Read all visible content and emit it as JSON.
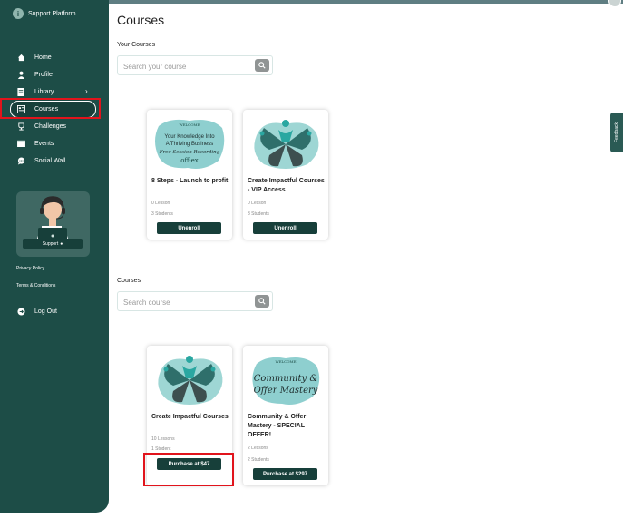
{
  "app": {
    "brand_name": "Support Platform"
  },
  "sidebar": {
    "items": [
      {
        "label": "Home",
        "icon": "home-icon"
      },
      {
        "label": "Profile",
        "icon": "person-icon"
      },
      {
        "label": "Library",
        "icon": "document-icon"
      },
      {
        "label": "Courses",
        "icon": "courses-icon"
      },
      {
        "label": "Challenges",
        "icon": "trophy-icon"
      },
      {
        "label": "Events",
        "icon": "calendar-icon"
      },
      {
        "label": "Social Wall",
        "icon": "chat-icon"
      }
    ],
    "support_label": "Support",
    "privacy_label": "Privacy Policy",
    "terms_label": "Terms & Conditions",
    "logout_label": "Log Out"
  },
  "page": {
    "title": "Courses"
  },
  "your_courses": {
    "heading": "Your Courses",
    "search_placeholder": "Search your course",
    "cards": [
      {
        "title": "8 Steps - Launch to profit",
        "lessons": "0 Lesson",
        "students": "3 Students",
        "button": "Unenroll",
        "thumb_lines": [
          "WELCOME",
          "Your Knowledge Into",
          "A Thriving Business",
          "Free Session Recording",
          "off-ex"
        ]
      },
      {
        "title": "Create Impactful Courses - VIP Access",
        "lessons": "0 Lesson",
        "students": "3 Students",
        "button": "Unenroll"
      }
    ]
  },
  "courses": {
    "heading": "Courses",
    "search_placeholder": "Search course",
    "cards": [
      {
        "title": "Create Impactful Courses",
        "lessons": "10 Lessons",
        "students": "1 Student",
        "button": "Purchase at $47"
      },
      {
        "title": "Community & Offer Mastery - SPECIAL OFFER!",
        "lessons": "2 Lessons",
        "students": "2 Students",
        "button": "Purchase at $297",
        "thumb_lines": [
          "WELCOME",
          "Community &",
          "Offer Mastery"
        ]
      }
    ]
  },
  "feedback_label": "Feedback",
  "colors": {
    "sidebar": "#1d4d47",
    "button": "#173f3a",
    "highlight": "#e1141c",
    "teal_light": "#8ecfcf"
  }
}
